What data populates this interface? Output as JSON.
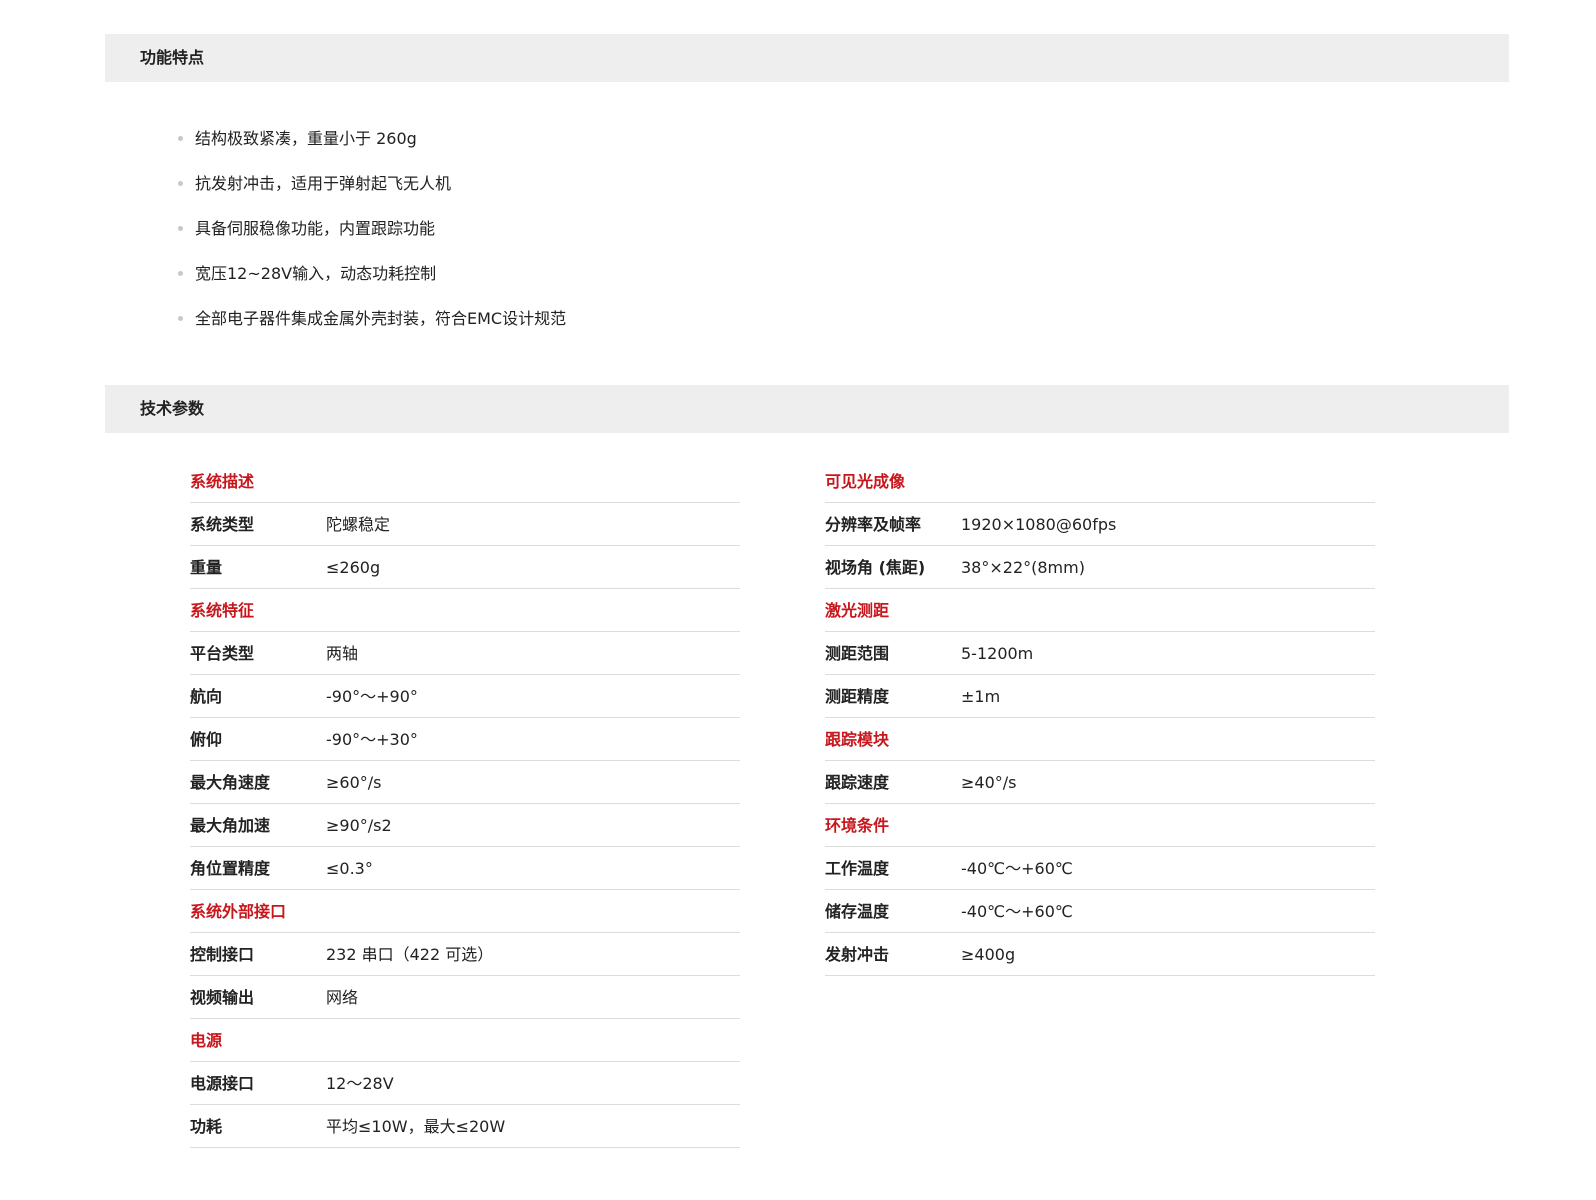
{
  "features": {
    "title": "功能特点",
    "items": [
      "结构极致紧凑，重量小于 260g",
      "抗发射冲击，适用于弹射起飞无人机",
      "具备伺服稳像功能，内置跟踪功能",
      "宽压12~28V输入，动态功耗控制",
      "全部电子器件集成金属外壳封装，符合EMC设计规范"
    ]
  },
  "params": {
    "title": "技术参数",
    "left": [
      {
        "group": true,
        "label": "系统描述",
        "value": ""
      },
      {
        "group": false,
        "label": "系统类型",
        "value": "陀螺稳定"
      },
      {
        "group": false,
        "label": "重量",
        "value": "≤260g"
      },
      {
        "group": true,
        "label": "系统特征",
        "value": ""
      },
      {
        "group": false,
        "label": "平台类型",
        "value": "两轴"
      },
      {
        "group": false,
        "label": "航向",
        "value": "-90°～+90°"
      },
      {
        "group": false,
        "label": "俯仰",
        "value": "-90°～+30°"
      },
      {
        "group": false,
        "label": "最大角速度",
        "value": "≥60°/s"
      },
      {
        "group": false,
        "label": "最大角加速",
        "value": "≥90°/s2"
      },
      {
        "group": false,
        "label": "角位置精度",
        "value": "≤0.3°"
      },
      {
        "group": true,
        "label": "系统外部接口",
        "value": ""
      },
      {
        "group": false,
        "label": "控制接口",
        "value": "232 串口（422 可选）"
      },
      {
        "group": false,
        "label": "视频输出",
        "value": "网络"
      },
      {
        "group": true,
        "label": "电源",
        "value": ""
      },
      {
        "group": false,
        "label": "电源接口",
        "value": "12～28V"
      },
      {
        "group": false,
        "label": "功耗",
        "value": "平均≤10W，最大≤20W"
      }
    ],
    "right": [
      {
        "group": true,
        "label": "可见光成像",
        "value": ""
      },
      {
        "group": false,
        "label": "分辨率及帧率",
        "value": "1920×1080@60fps"
      },
      {
        "group": false,
        "label": "视场角 (焦距)",
        "value": "38°×22°(8mm)"
      },
      {
        "group": true,
        "label": "激光测距",
        "value": ""
      },
      {
        "group": false,
        "label": "测距范围",
        "value": "5-1200m"
      },
      {
        "group": false,
        "label": "测距精度",
        "value": "±1m"
      },
      {
        "group": true,
        "label": "跟踪模块",
        "value": ""
      },
      {
        "group": false,
        "label": "跟踪速度",
        "value": "≥40°/s"
      },
      {
        "group": true,
        "label": "环境条件",
        "value": ""
      },
      {
        "group": false,
        "label": "工作温度",
        "value": "-40℃～+60℃"
      },
      {
        "group": false,
        "label": "储存温度",
        "value": "-40℃～+60℃"
      },
      {
        "group": false,
        "label": "发射冲击",
        "value": "≥400g"
      }
    ]
  },
  "colors": {
    "group_label": "#c8161d",
    "bar_background": "#eeeeee",
    "divider": "#dcdcdc"
  }
}
